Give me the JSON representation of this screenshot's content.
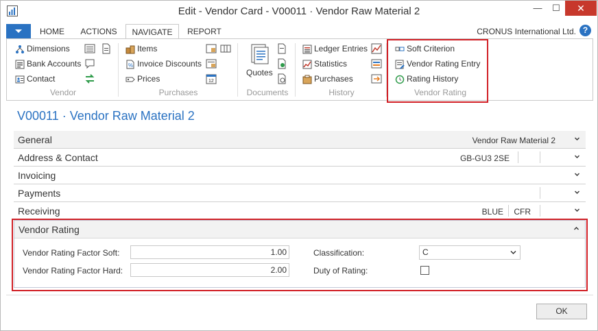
{
  "window": {
    "title": "Edit - Vendor Card - V00011 · Vendor Raw Material 2",
    "min": "—",
    "max": "☐",
    "close": "✕"
  },
  "ribbon_tabs": [
    "HOME",
    "ACTIONS",
    "NAVIGATE",
    "REPORT"
  ],
  "company": "CRONUS International Ltd.",
  "help": "?",
  "ribbon": {
    "vendor": {
      "items": [
        "Dimensions",
        "Bank Accounts",
        "Contact"
      ],
      "label": "Vendor"
    },
    "purchases": {
      "items": [
        "Items",
        "Invoice Discounts",
        "Prices"
      ],
      "label": "Purchases"
    },
    "documents": {
      "items": [
        "Quotes"
      ],
      "label": "Documents"
    },
    "history": {
      "items": [
        "Ledger Entries",
        "Statistics",
        "Purchases"
      ],
      "label": "History"
    },
    "vendor_rating": {
      "items": [
        "Soft Criterion",
        "Vendor Rating Entry",
        "Rating History"
      ],
      "label": "Vendor Rating"
    }
  },
  "page_title": "V00011 · Vendor Raw Material 2",
  "fasttabs": [
    {
      "title": "General",
      "values": [
        "Vendor Raw Material 2"
      ]
    },
    {
      "title": "Address & Contact",
      "values": [
        "GB-GU3 2SE",
        ""
      ]
    },
    {
      "title": "Invoicing",
      "values": []
    },
    {
      "title": "Payments",
      "values": [
        ""
      ]
    },
    {
      "title": "Receiving",
      "values": [
        "BLUE",
        "CFR",
        ""
      ]
    }
  ],
  "vendor_rating": {
    "title": "Vendor Rating",
    "factor_soft_label": "Vendor Rating Factor Soft:",
    "factor_soft_value": "1.00",
    "factor_hard_label": "Vendor Rating Factor Hard:",
    "factor_hard_value": "2.00",
    "classification_label": "Classification:",
    "classification_value": "C",
    "duty_label": "Duty of Rating:",
    "duty_checked": false
  },
  "ok_label": "OK",
  "colors": {
    "accent": "#2a72c2",
    "highlight": "#d11f25"
  }
}
